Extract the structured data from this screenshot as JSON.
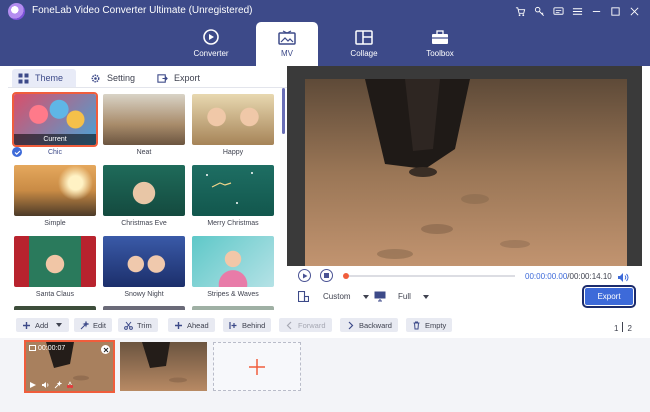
{
  "window": {
    "title": "FoneLab Video Converter Ultimate (Unregistered)",
    "controls": [
      "cart-icon",
      "key-icon",
      "feedback-icon",
      "menu-icon",
      "minimize-icon",
      "maximize-icon",
      "close-icon"
    ]
  },
  "nav": {
    "tabs": [
      {
        "label": "Converter",
        "icon": "converter-icon"
      },
      {
        "label": "MV",
        "icon": "mv-icon",
        "active": true
      },
      {
        "label": "Collage",
        "icon": "collage-icon"
      },
      {
        "label": "Toolbox",
        "icon": "toolbox-icon"
      }
    ]
  },
  "sub_tabs": [
    {
      "label": "Theme",
      "active": true
    },
    {
      "label": "Setting"
    },
    {
      "label": "Export"
    }
  ],
  "themes": [
    {
      "label": "Chic",
      "selected": true,
      "badge": "Current"
    },
    {
      "label": "Neat"
    },
    {
      "label": "Happy"
    },
    {
      "label": "Simple"
    },
    {
      "label": "Christmas Eve"
    },
    {
      "label": "Merry Christmas"
    },
    {
      "label": "Santa Claus"
    },
    {
      "label": "Snowy Night"
    },
    {
      "label": "Stripes & Waves"
    }
  ],
  "player": {
    "current_time": "00:00:00.00",
    "total_time": "/00:00:14.10",
    "aspect": "Custom",
    "mode": "Full",
    "export_label": "Export",
    "progress": 0
  },
  "toolbar": {
    "add": "Add",
    "edit": "Edit",
    "trim": "Trim",
    "ahead": "Ahead",
    "behind": "Behind",
    "forward": "Forward",
    "backward": "Backward",
    "empty": "Empty",
    "page": "1",
    "pages": "2"
  },
  "timeline": {
    "clips": [
      {
        "duration": "00:00:07",
        "selected": true
      },
      {
        "duration": ""
      }
    ]
  },
  "colors": {
    "nav_bg": "#3d4a89",
    "accent": "#3d6ad9",
    "selected": "#f05d3c"
  }
}
